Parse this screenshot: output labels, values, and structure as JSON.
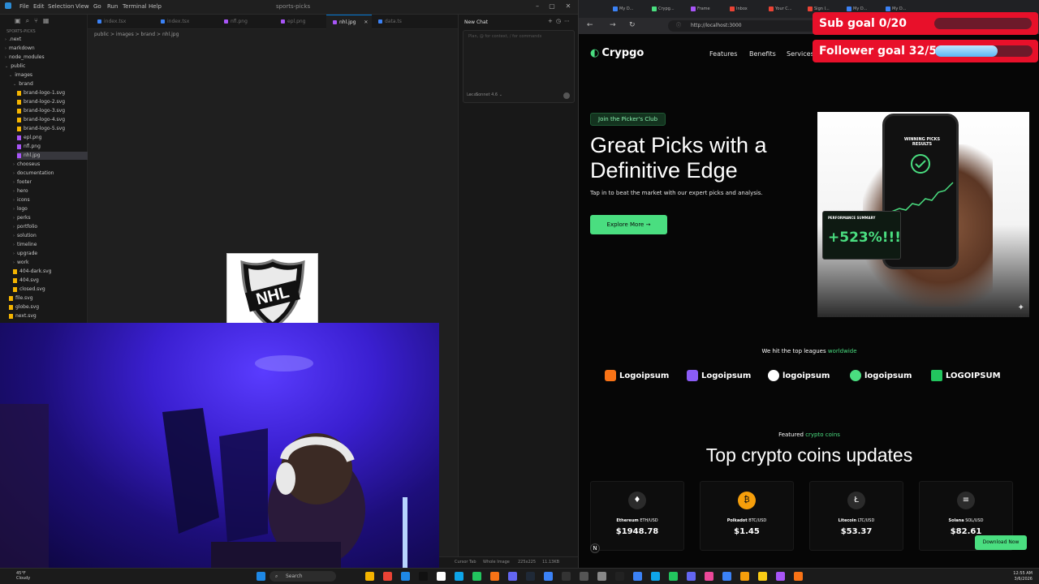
{
  "vscode": {
    "menu": [
      "File",
      "Edit",
      "Selection",
      "View",
      "Go",
      "Run",
      "Terminal",
      "Help"
    ],
    "window_title": "sports-picks",
    "sidebar_title": "SPORTS-PICKS",
    "tree": [
      {
        "label": ".next",
        "type": "folder",
        "depth": 0
      },
      {
        "label": "markdown",
        "type": "folder",
        "depth": 0
      },
      {
        "label": "node_modules",
        "type": "folder",
        "depth": 0
      },
      {
        "label": "public",
        "type": "folder",
        "depth": 0,
        "open": true
      },
      {
        "label": "images",
        "type": "folder",
        "depth": 1,
        "open": true
      },
      {
        "label": "brand",
        "type": "folder",
        "depth": 2,
        "open": true
      },
      {
        "label": "brand-logo-1.svg",
        "type": "file",
        "depth": 3
      },
      {
        "label": "brand-logo-2.svg",
        "type": "file",
        "depth": 3
      },
      {
        "label": "brand-logo-3.svg",
        "type": "file",
        "depth": 3
      },
      {
        "label": "brand-logo-4.svg",
        "type": "file",
        "depth": 3
      },
      {
        "label": "brand-logo-5.svg",
        "type": "file",
        "depth": 3
      },
      {
        "label": "epl.png",
        "type": "file",
        "depth": 3
      },
      {
        "label": "nfl.png",
        "type": "file",
        "depth": 3
      },
      {
        "label": "nhl.jpg",
        "type": "file",
        "depth": 3,
        "selected": true
      },
      {
        "label": "chooseus",
        "type": "folder",
        "depth": 2
      },
      {
        "label": "documentation",
        "type": "folder",
        "depth": 2
      },
      {
        "label": "footer",
        "type": "folder",
        "depth": 2
      },
      {
        "label": "hero",
        "type": "folder",
        "depth": 2
      },
      {
        "label": "icons",
        "type": "folder",
        "depth": 2
      },
      {
        "label": "logo",
        "type": "folder",
        "depth": 2
      },
      {
        "label": "perks",
        "type": "folder",
        "depth": 2
      },
      {
        "label": "portfolio",
        "type": "folder",
        "depth": 2
      },
      {
        "label": "solution",
        "type": "folder",
        "depth": 2
      },
      {
        "label": "timeline",
        "type": "folder",
        "depth": 2
      },
      {
        "label": "upgrade",
        "type": "folder",
        "depth": 2
      },
      {
        "label": "work",
        "type": "folder",
        "depth": 2
      },
      {
        "label": "404-dark.svg",
        "type": "file",
        "depth": 2
      },
      {
        "label": "404.svg",
        "type": "file",
        "depth": 2
      },
      {
        "label": "closed.svg",
        "type": "file",
        "depth": 2
      },
      {
        "label": "file.svg",
        "type": "file",
        "depth": 1
      },
      {
        "label": "globe.svg",
        "type": "file",
        "depth": 1
      },
      {
        "label": "next.svg",
        "type": "file",
        "depth": 1
      }
    ],
    "tabs": [
      {
        "label": "index.tsx",
        "color": "#3b82f6"
      },
      {
        "label": "index.tsx",
        "color": "#3b82f6"
      },
      {
        "label": "nfl.png",
        "color": "#a855f7"
      },
      {
        "label": "epl.png",
        "color": "#a855f7"
      },
      {
        "label": "nhl.jpg",
        "color": "#a855f7",
        "active": true
      },
      {
        "label": "data.ts",
        "color": "#3b82f6"
      }
    ],
    "breadcrumb": "public > images > brand > nhl.jpg",
    "chat": {
      "title": "New Chat",
      "placeholder": "Plan, @ for context, / for commands",
      "mode": "∞",
      "model": "Sonnet 4.6",
      "local_label": "Local"
    },
    "status": {
      "left": "",
      "right_tab": "Cursor Tab",
      "right_image": "Whole Image",
      "right_size": "225x225",
      "right_filesize": "11.13KB"
    },
    "nhl_image_text": "NHL"
  },
  "browser": {
    "url": "http://localhost:3000",
    "tabs": [
      "My D...",
      "Crypg...",
      "Frame",
      "Inbox",
      "Your C...",
      "Sign I...",
      "My D...",
      "My D..."
    ]
  },
  "site": {
    "logo": "Crypgo",
    "nav": [
      "Features",
      "Benefits",
      "Services"
    ],
    "badge": "Join the Picker's Club",
    "hero_title": "Great Picks with a Definitive Edge",
    "hero_sub": "Tap in to beat the market with our expert picks and analysis.",
    "explore_btn": "Explore More",
    "phone_title": "WINNING PICKS RESULTS",
    "perf_title": "PERFORMANCE SUMMARY",
    "perf_value": "+523%!!!",
    "leagues_prefix": "We hit the top leagues ",
    "leagues_highlight": "worldwide",
    "partners": [
      "Logoipsum",
      "Logoipsum",
      "logoipsum",
      "logoipsum",
      "LOGOIPSUM"
    ],
    "featured_prefix": "Featured ",
    "featured_highlight": "crypto coins",
    "section_title": "Top crypto coins updates",
    "coins": [
      {
        "icon": "ethereum-icon",
        "glyph": "♦",
        "name": "Ethereum",
        "pair": "ETH/USD",
        "price": "$1948.78"
      },
      {
        "icon": "polkadot-icon",
        "glyph": "₿",
        "name": "Polkadot",
        "pair": "BTC/USD",
        "price": "$1.45"
      },
      {
        "icon": "litecoin-icon",
        "glyph": "Ł",
        "name": "Litecoin",
        "pair": "LTC/USD",
        "price": "$53.37"
      },
      {
        "icon": "solana-icon",
        "glyph": "≡",
        "name": "Solana",
        "pair": "SOL/USD",
        "price": "$82.61"
      }
    ],
    "download_btn": "Download Now",
    "accent": "#4ade80"
  },
  "overlays": {
    "sub_goal": {
      "label": "Sub goal 0/20",
      "progress": 0.0
    },
    "follower_goal": {
      "label": "Follower goal 32/50",
      "progress": 0.64
    }
  },
  "taskbar": {
    "weather_temp": "45°F",
    "weather_desc": "Cloudy",
    "search": "Search",
    "time": "12:55 AM",
    "date": "3/6/2026"
  }
}
